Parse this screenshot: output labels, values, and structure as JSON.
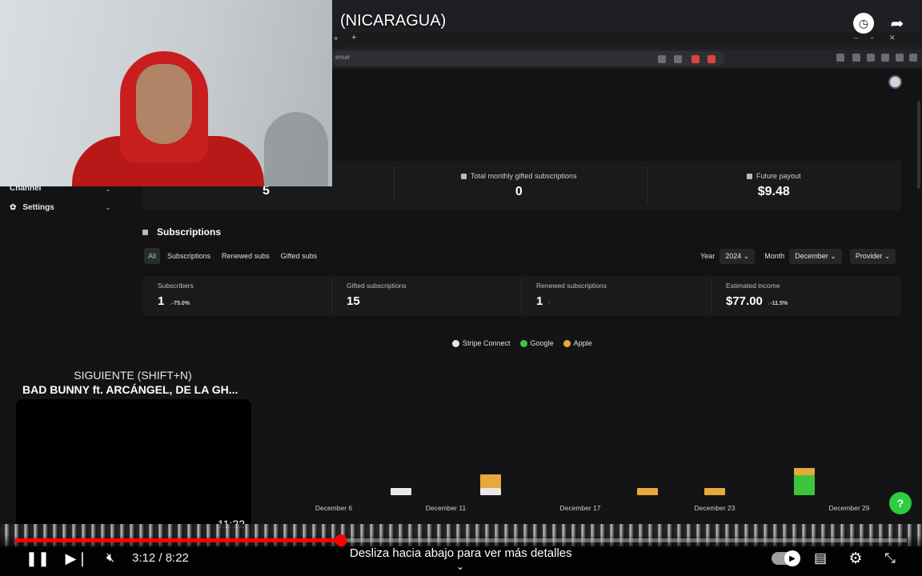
{
  "video": {
    "title": "(NICARAGUA)",
    "current_time": "3:12 / 8:22",
    "progress": 0.365,
    "swipe_hint": "Desliza hacia abajo para ver más detalles"
  },
  "up_next": {
    "kicker": "SIGUIENTE (SHIFT+N)",
    "title": "BAD BUNNY ft. ARCÁNGEL, DE LA GH...",
    "duration": "11:22"
  },
  "browser": {
    "address": "enue",
    "tab_close": "×",
    "tab_add": "+",
    "win_min": "–",
    "win_max": "▫",
    "win_close": "✕"
  },
  "sidebar": {
    "items": [
      {
        "label": "Channel"
      },
      {
        "label": "Settings"
      }
    ]
  },
  "summary": {
    "first_value": "5",
    "gifted_label": "Total monthly gifted subscriptions",
    "gifted_value": "0",
    "payout_label": "Future payout",
    "payout_value": "$9.48"
  },
  "subscriptions": {
    "title": "Subscriptions",
    "tabs": [
      "All",
      "Subscriptions",
      "Renewed subs",
      "Gifted subs"
    ],
    "filters": {
      "year_label": "Year",
      "year_value": "2024",
      "month_label": "Month",
      "month_value": "December",
      "provider_value": "Provider"
    },
    "metrics": [
      {
        "label": "Subscribers",
        "value": "1",
        "delta": "-75.0%"
      },
      {
        "label": "Gifted subscriptions",
        "value": "15",
        "delta": ""
      },
      {
        "label": "Renewed subscriptions",
        "value": "1",
        "delta": ""
      },
      {
        "label": "Estimated income",
        "value": "$77.00",
        "delta": "-11.5%"
      }
    ]
  },
  "colors": {
    "stripe": "#e8e8e8",
    "google": "#3ec43e",
    "apple": "#e7a93b",
    "accent_red": "#ff0000"
  },
  "chart_data": {
    "type": "bar",
    "legend": [
      "Stripe Connect",
      "Google",
      "Apple"
    ],
    "x_tick_labels": [
      "December 6",
      "December 11",
      "December 17",
      "December 23",
      "December 29"
    ],
    "categories": [
      "December 9",
      "December 11",
      "December 20",
      "December 23",
      "December 27"
    ],
    "series": [
      {
        "name": "Stripe Connect",
        "values": [
          1,
          1,
          0,
          0,
          0
        ]
      },
      {
        "name": "Google",
        "values": [
          0,
          0,
          0,
          0,
          3
        ]
      },
      {
        "name": "Apple",
        "values": [
          0,
          2,
          1,
          1,
          1
        ]
      }
    ]
  }
}
